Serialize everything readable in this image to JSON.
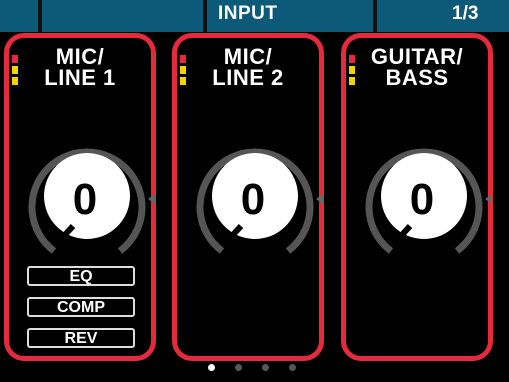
{
  "header": {
    "title": "INPUT",
    "page": "1/3"
  },
  "channels": [
    {
      "name_line1": "MIC/",
      "name_line2": "LINE 1",
      "value": "0",
      "buttons": [
        "EQ",
        "COMP",
        "REV"
      ]
    },
    {
      "name_line1": "MIC/",
      "name_line2": "LINE 2",
      "value": "0"
    },
    {
      "name_line1": "GUITAR/",
      "name_line2": "BASS",
      "value": "0"
    }
  ],
  "pagination": {
    "count": 4,
    "active_index": 0
  },
  "colors": {
    "frame": "#e42a3c",
    "header_bg": "#0d5a78",
    "meter_yellow": "#f2d400"
  },
  "icons": [
    "knob-icon",
    "arrow-right-icon",
    "level-meter-icon"
  ]
}
